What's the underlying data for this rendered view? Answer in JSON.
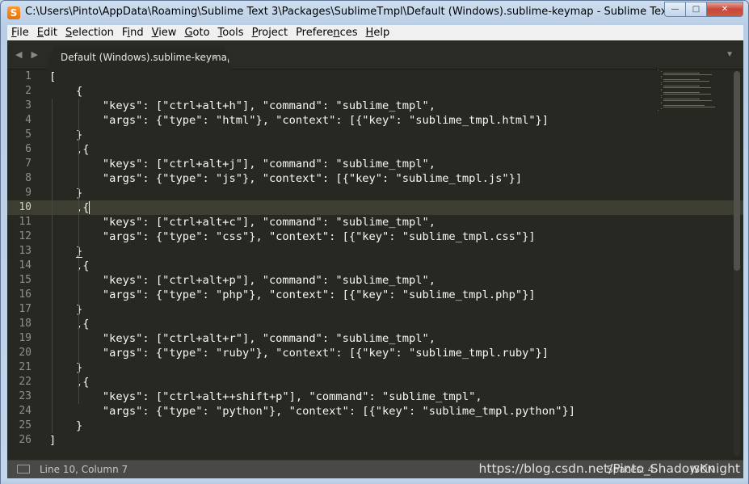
{
  "window": {
    "title": "C:\\Users\\Pinto\\AppData\\Roaming\\Sublime Text 3\\Packages\\SublimeTmpl\\Default (Windows).sublime-keymap - Sublime Text",
    "app_icon_glyph": "S",
    "controls": {
      "minimize": "—",
      "maximize": "□",
      "close": "✕"
    }
  },
  "menu": [
    {
      "pre": "",
      "key": "F",
      "post": "ile"
    },
    {
      "pre": "",
      "key": "E",
      "post": "dit"
    },
    {
      "pre": "",
      "key": "S",
      "post": "election"
    },
    {
      "pre": "F",
      "key": "i",
      "post": "nd"
    },
    {
      "pre": "",
      "key": "V",
      "post": "iew"
    },
    {
      "pre": "",
      "key": "G",
      "post": "oto"
    },
    {
      "pre": "",
      "key": "T",
      "post": "ools"
    },
    {
      "pre": "",
      "key": "P",
      "post": "roject"
    },
    {
      "pre": "Prefere",
      "key": "n",
      "post": "ces"
    },
    {
      "pre": "",
      "key": "H",
      "post": "elp"
    }
  ],
  "tabs": {
    "nav_arrows": "◀ ▶",
    "active_tab": "Default (Windows).sublime-keymap",
    "close_glyph": "×",
    "dropdown_glyph": "▼"
  },
  "editor": {
    "active_line": 10,
    "colors": {
      "background": "#272822",
      "text": "#f8f8f2",
      "gutter_text": "#8f908a",
      "active_line_bg": "#3e3d32"
    },
    "lines": [
      "[",
      "    {",
      "        \"keys\": [\"ctrl+alt+h\"], \"command\": \"sublime_tmpl\",",
      "        \"args\": {\"type\": \"html\"}, \"context\": [{\"key\": \"sublime_tmpl.html\"}]",
      "    }",
      "    ,{",
      "        \"keys\": [\"ctrl+alt+j\"], \"command\": \"sublime_tmpl\",",
      "        \"args\": {\"type\": \"js\"}, \"context\": [{\"key\": \"sublime_tmpl.js\"}]",
      "    }",
      "    ,{",
      "        \"keys\": [\"ctrl+alt+c\"], \"command\": \"sublime_tmpl\",",
      "        \"args\": {\"type\": \"css\"}, \"context\": [{\"key\": \"sublime_tmpl.css\"}]",
      "    }",
      "    ,{",
      "        \"keys\": [\"ctrl+alt+p\"], \"command\": \"sublime_tmpl\",",
      "        \"args\": {\"type\": \"php\"}, \"context\": [{\"key\": \"sublime_tmpl.php\"}]",
      "    }",
      "    ,{",
      "        \"keys\": [\"ctrl+alt+r\"], \"command\": \"sublime_tmpl\",",
      "        \"args\": {\"type\": \"ruby\"}, \"context\": [{\"key\": \"sublime_tmpl.ruby\"}]",
      "    }",
      "    ,{",
      "        \"keys\": [\"ctrl+alt++shift+p\"], \"command\": \"sublime_tmpl\",",
      "        \"args\": {\"type\": \"python\"}, \"context\": [{\"key\": \"sublime_tmpl.python\"}]",
      "    }",
      "]"
    ]
  },
  "status": {
    "position": "Line 10, Column 7",
    "spaces": "Spaces: 4",
    "syntax": "JSON"
  },
  "watermark": "https://blog.csdn.net/Pinto_ShadowKnight"
}
